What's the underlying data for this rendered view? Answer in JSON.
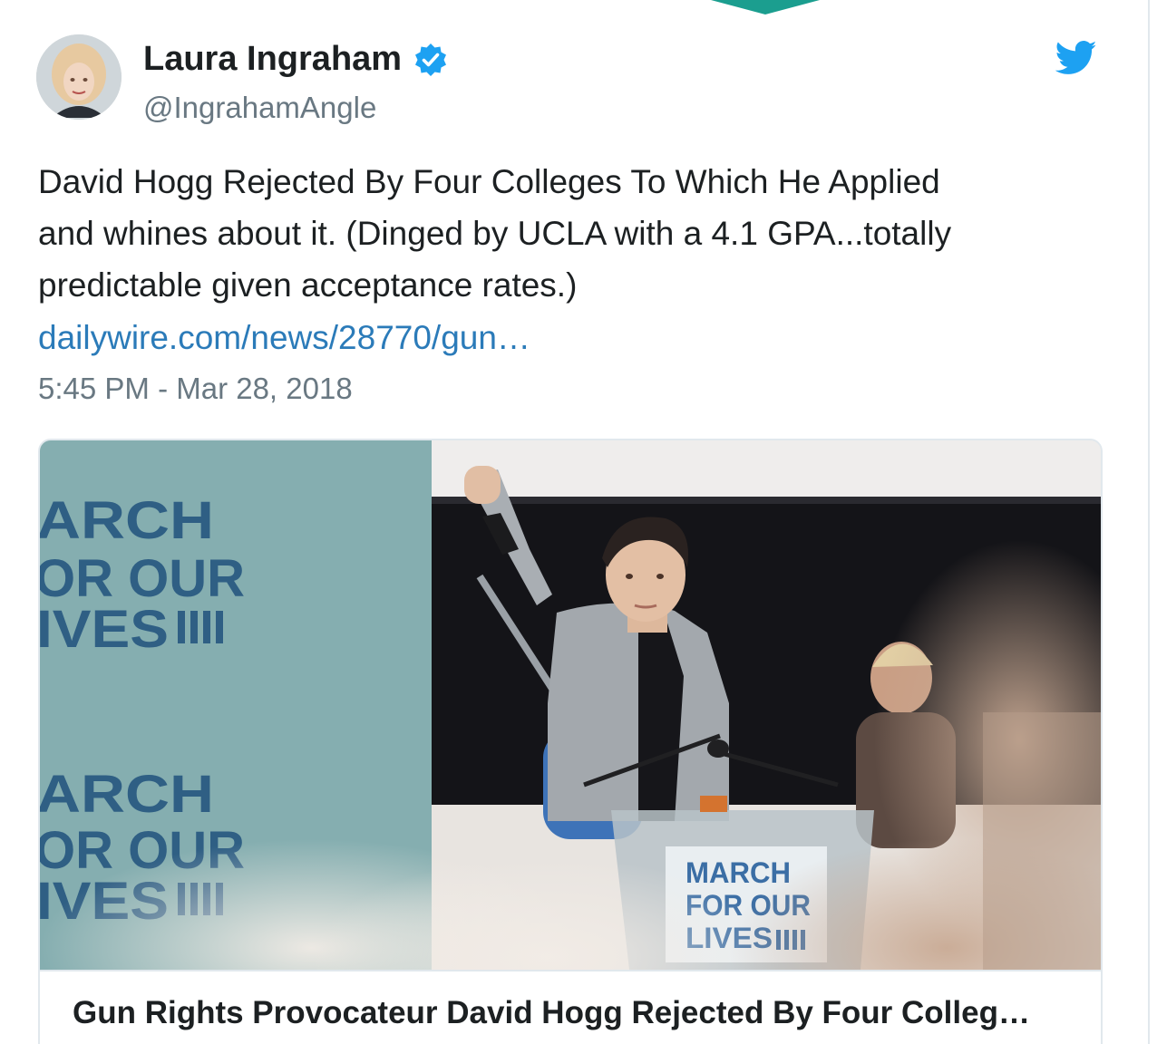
{
  "tweet": {
    "author": {
      "display_name": "Laura Ingraham",
      "handle": "@IngrahamAngle",
      "verified": true
    },
    "text_lines": [
      "David Hogg Rejected By Four Colleges To Which He Applied",
      "and whines about it. (Dinged by UCLA with a 4.1 GPA...totally",
      "predictable given acceptance rates.)"
    ],
    "link_text": "dailywire.com/news/28770/gun…",
    "timestamp": "5:45 PM - Mar 28, 2018",
    "card": {
      "title": "Gun Rights Provocateur David Hogg Rejected By Four Colleg…",
      "image_signs": {
        "banner_text": "MARCH\nFOR OUR\nLIVES",
        "podium_text": "MARCH\nFOR OUR\nLIVES"
      }
    }
  },
  "icons": {
    "verified": "verified-badge-icon",
    "brand": "twitter-bird-icon"
  },
  "colors": {
    "link": "#2b7bb9",
    "verified": "#1da1f2",
    "brand": "#1da1f2",
    "muted_text": "#697882",
    "pointer": "#1b9e8f"
  }
}
